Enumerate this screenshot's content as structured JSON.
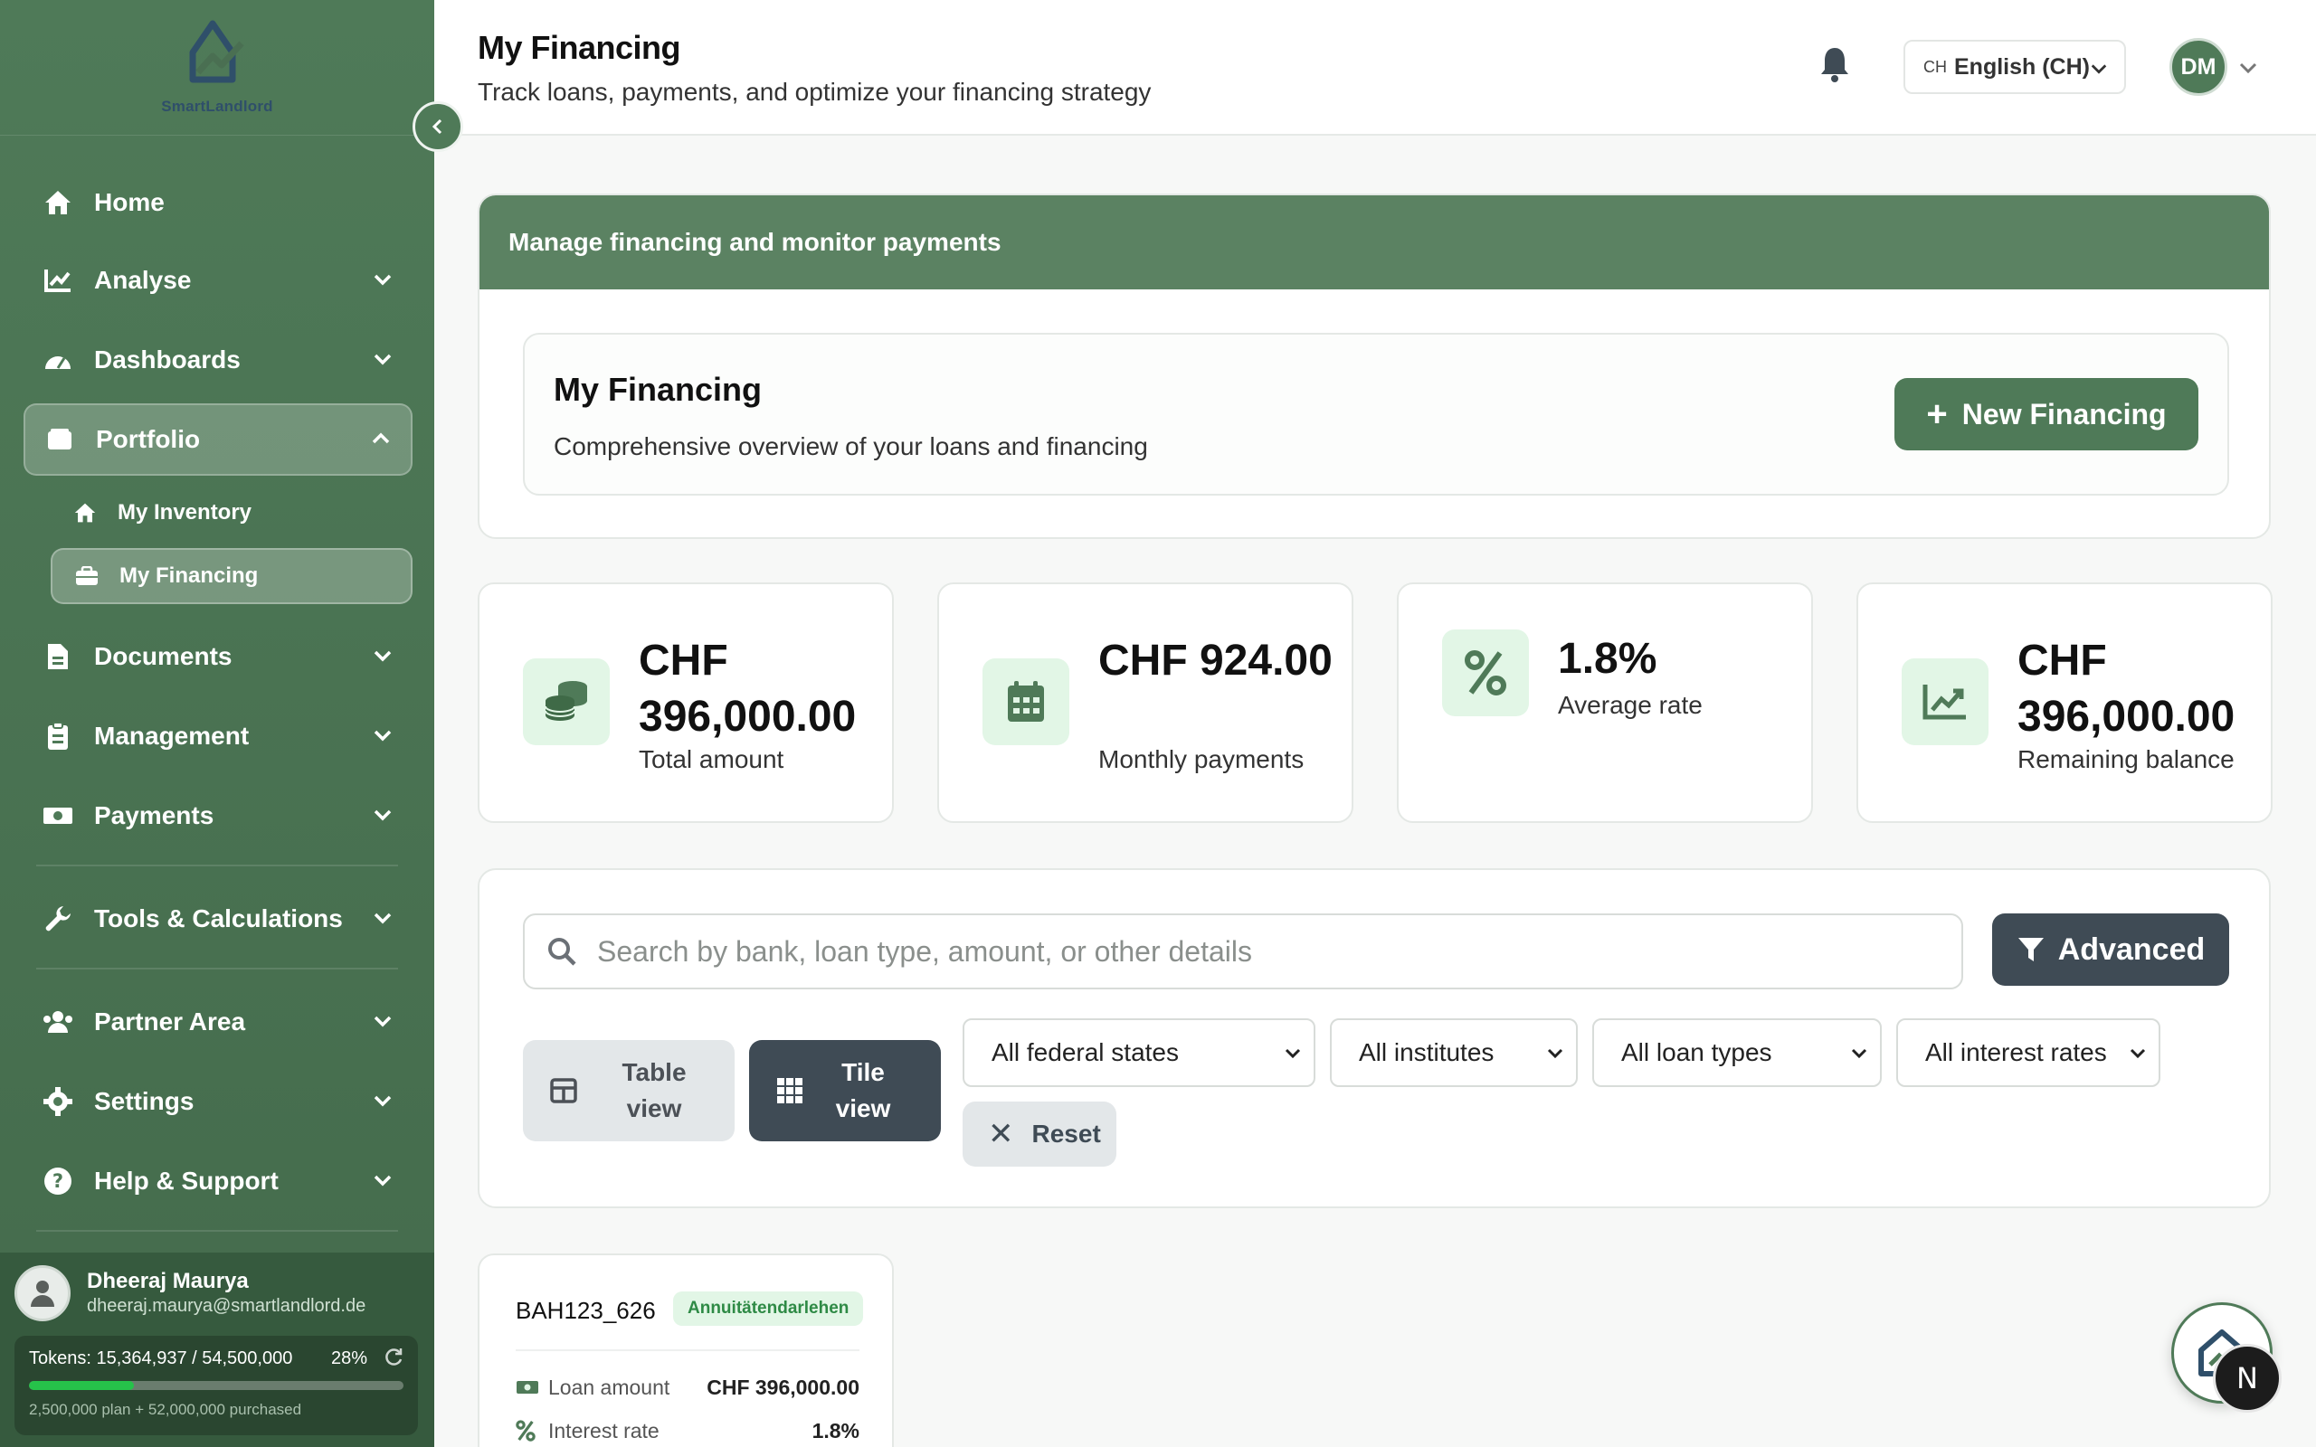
{
  "sidebar": {
    "logo_text": "SmartLandlord",
    "items": [
      {
        "label": "Home",
        "icon": "home-icon"
      },
      {
        "label": "Analyse",
        "icon": "chart-line-icon"
      },
      {
        "label": "Dashboards",
        "icon": "gauge-icon"
      },
      {
        "label": "Portfolio",
        "icon": "wallet-icon"
      },
      {
        "label": "Documents",
        "icon": "file-icon"
      },
      {
        "label": "Management",
        "icon": "clipboard-icon"
      },
      {
        "label": "Payments",
        "icon": "money-icon"
      },
      {
        "label": "Tools & Calculations",
        "icon": "wrench-icon"
      },
      {
        "label": "Partner Area",
        "icon": "users-icon"
      },
      {
        "label": "Settings",
        "icon": "gear-icon"
      },
      {
        "label": "Help & Support",
        "icon": "question-icon"
      }
    ],
    "sub_items": [
      {
        "label": "My Inventory",
        "icon": "home-icon"
      },
      {
        "label": "My Financing",
        "icon": "briefcase-icon"
      }
    ],
    "user": {
      "name": "Dheeraj Maurya",
      "email": "dheeraj.maurya@smartlandlord.de"
    },
    "tokens": {
      "text": "Tokens: 15,364,937 / 54,500,000",
      "percent_label": "28%",
      "percent": 28,
      "sub": "2,500,000 plan + 52,000,000 purchased"
    }
  },
  "header": {
    "title": "My Financing",
    "subtitle": "Track loans, payments, and optimize your financing strategy",
    "lang_flag": "CH",
    "lang_label": "English (CH)",
    "avatar_initials": "DM"
  },
  "panel": {
    "banner": "Manage financing and monitor payments",
    "title": "My Financing",
    "subtitle": "Comprehensive overview of your loans and financing",
    "new_button": "New Financing"
  },
  "stats": [
    {
      "value": "CHF 396,000.00",
      "label": "Total amount",
      "icon": "coins-icon"
    },
    {
      "value": "CHF 924.00",
      "label": "Monthly payments",
      "icon": "calendar-icon"
    },
    {
      "value": "1.8%",
      "label": "Average rate",
      "icon": "percent-icon"
    },
    {
      "value": "CHF 396,000.00",
      "label": "Remaining balance",
      "icon": "trend-icon"
    }
  ],
  "filters": {
    "search_placeholder": "Search by bank, loan type, amount, or other details",
    "advanced": "Advanced",
    "table_view": "Table view",
    "tile_view": "Tile view",
    "federal_states": "All federal states",
    "institutes": "All institutes",
    "loan_types": "All loan types",
    "interest_rates": "All interest rates",
    "reset": "Reset"
  },
  "loan": {
    "id": "BAH123_626",
    "badge": "Annuitätendarlehen",
    "rows": [
      {
        "label": "Loan amount",
        "value": "CHF 396,000.00"
      },
      {
        "label": "Interest rate",
        "value": "1.8%"
      }
    ]
  },
  "floating": {
    "badge": "N"
  },
  "colors": {
    "primary": "#4f7a58",
    "dark": "#3f4b55",
    "accent_light": "#e2f6e6"
  }
}
